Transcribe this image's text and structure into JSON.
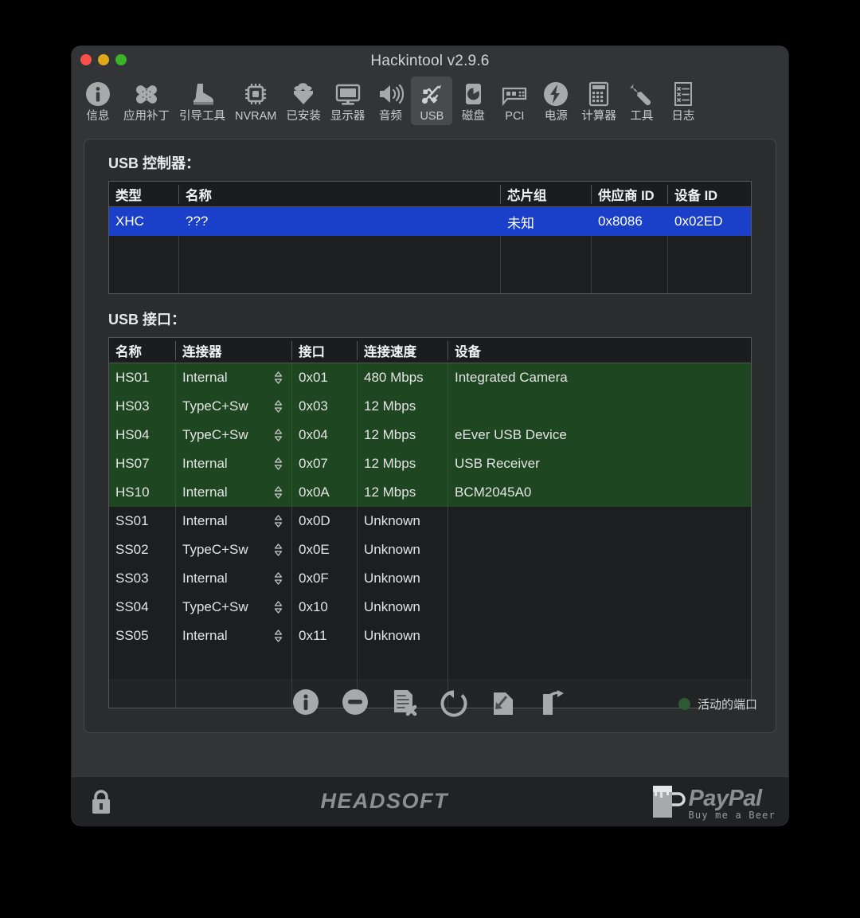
{
  "window": {
    "title": "Hackintool v2.9.6",
    "traffic_lights": [
      {
        "name": "close",
        "color": "#f9514a"
      },
      {
        "name": "minimize",
        "color": "#dfa71b"
      },
      {
        "name": "zoom",
        "color": "#3bb327"
      }
    ]
  },
  "toolbar": {
    "items": [
      {
        "label": "信息",
        "icon": "info-icon",
        "selected": false
      },
      {
        "label": "应用补丁",
        "icon": "bandage-icon",
        "selected": false
      },
      {
        "label": "引导工具",
        "icon": "boot-icon",
        "selected": false
      },
      {
        "label": "NVRAM",
        "icon": "chip-icon",
        "selected": false
      },
      {
        "label": "已安装",
        "icon": "kext-icon",
        "selected": false
      },
      {
        "label": "显示器",
        "icon": "display-icon",
        "selected": false
      },
      {
        "label": "音频",
        "icon": "speaker-icon",
        "selected": false
      },
      {
        "label": "USB",
        "icon": "usb-icon",
        "selected": true
      },
      {
        "label": "磁盘",
        "icon": "disk-icon",
        "selected": false
      },
      {
        "label": "PCI",
        "icon": "pci-card-icon",
        "selected": false
      },
      {
        "label": "电源",
        "icon": "power-bolt-icon",
        "selected": false
      },
      {
        "label": "计算器",
        "icon": "calculator-icon",
        "selected": false
      },
      {
        "label": "工具",
        "icon": "wrench-icon",
        "selected": false
      },
      {
        "label": "日志",
        "icon": "log-list-icon",
        "selected": false
      }
    ]
  },
  "controllers": {
    "title": "USB 控制器：",
    "columns": [
      "类型",
      "名称",
      "芯片组",
      "供应商 ID",
      "设备 ID"
    ],
    "rows": [
      {
        "type": "XHC",
        "name": "???",
        "chipset": "未知",
        "vendor_id": "0x8086",
        "device_id": "0x02ED",
        "selected": true
      }
    ],
    "empty_rows": 2,
    "selection_color": "#1a3fc8"
  },
  "ports": {
    "title": "USB 接口：",
    "columns": [
      "名称",
      "连接器",
      "接口",
      "连接速度",
      "设备"
    ],
    "active_color": "#1e4620",
    "rows": [
      {
        "name": "HS01",
        "connector": "Internal",
        "port": "0x01",
        "speed": "480 Mbps",
        "device": "Integrated Camera",
        "active": true
      },
      {
        "name": "HS03",
        "connector": "TypeC+Sw",
        "port": "0x03",
        "speed": "12 Mbps",
        "device": "",
        "active": true
      },
      {
        "name": "HS04",
        "connector": "TypeC+Sw",
        "port": "0x04",
        "speed": "12 Mbps",
        "device": "eEver USB Device",
        "active": true
      },
      {
        "name": "HS07",
        "connector": "Internal",
        "port": "0x07",
        "speed": "12 Mbps",
        "device": "USB Receiver",
        "active": true
      },
      {
        "name": "HS10",
        "connector": "Internal",
        "port": "0x0A",
        "speed": "12 Mbps",
        "device": "BCM2045A0",
        "active": true
      },
      {
        "name": "SS01",
        "connector": "Internal",
        "port": "0x0D",
        "speed": "Unknown",
        "device": "",
        "active": false
      },
      {
        "name": "SS02",
        "connector": "TypeC+Sw",
        "port": "0x0E",
        "speed": "Unknown",
        "device": "",
        "active": false
      },
      {
        "name": "SS03",
        "connector": "Internal",
        "port": "0x0F",
        "speed": "Unknown",
        "device": "",
        "active": false
      },
      {
        "name": "SS04",
        "connector": "TypeC+Sw",
        "port": "0x10",
        "speed": "Unknown",
        "device": "",
        "active": false
      },
      {
        "name": "SS05",
        "connector": "Internal",
        "port": "0x11",
        "speed": "Unknown",
        "device": "",
        "active": false
      }
    ],
    "empty_rows": 2
  },
  "actions": [
    {
      "name": "info-button",
      "icon": "info-circle-icon"
    },
    {
      "name": "remove-button",
      "icon": "minus-circle-icon"
    },
    {
      "name": "clear-button",
      "icon": "document-x-icon"
    },
    {
      "name": "refresh-button",
      "icon": "refresh-icon"
    },
    {
      "name": "import-button",
      "icon": "import-document-icon"
    },
    {
      "name": "export-button",
      "icon": "export-document-icon"
    }
  ],
  "status": {
    "label": "活动的端口",
    "dot_color": "#2d5a32"
  },
  "footer": {
    "lock_icon": "lock-icon",
    "brand": "HEADSOFT",
    "paypal_title": "PayPal",
    "paypal_sub": "Buy me a Beer"
  }
}
